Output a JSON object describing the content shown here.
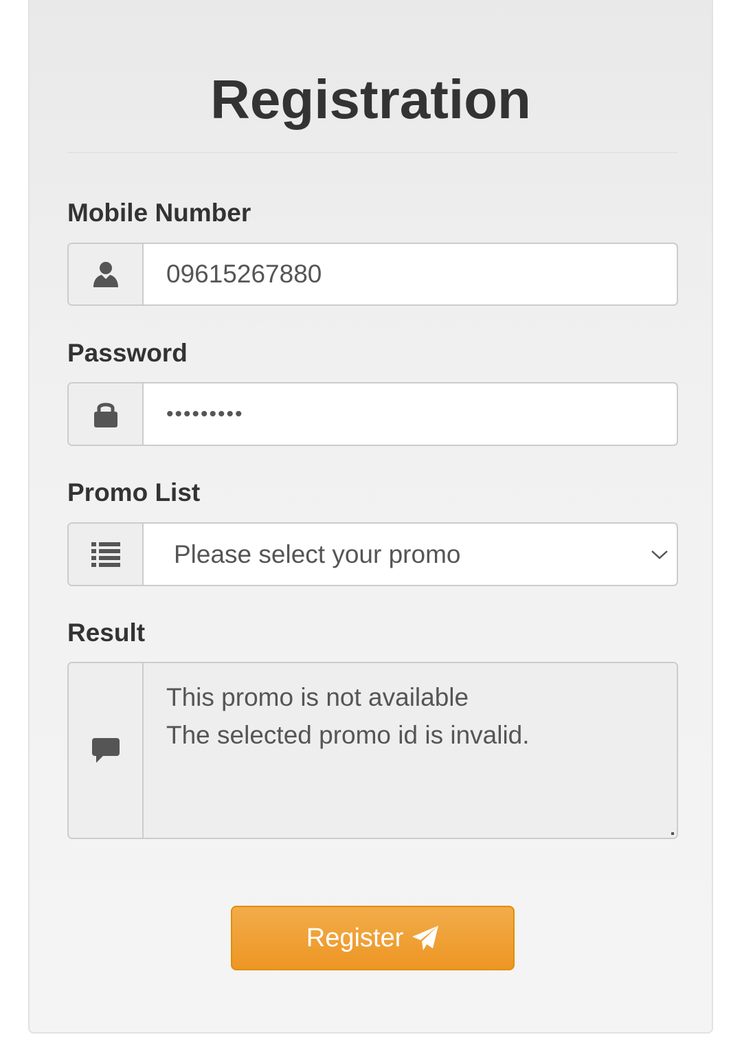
{
  "form": {
    "title": "Registration",
    "mobile": {
      "label": "Mobile Number",
      "value": "09615267880",
      "icon": "user-icon"
    },
    "password": {
      "label": "Password",
      "value": "•••••••••",
      "icon": "lock-icon"
    },
    "promo": {
      "label": "Promo List",
      "selected": "Please select your promo",
      "icon": "list-icon"
    },
    "result": {
      "label": "Result",
      "lines": [
        "This promo is not available",
        "The selected promo id is invalid."
      ],
      "icon": "comment-icon"
    },
    "submit": {
      "label": "Register",
      "icon": "paper-plane-icon"
    }
  },
  "colors": {
    "accent": "#ED9624",
    "text": "#333333",
    "muted": "#555555"
  }
}
